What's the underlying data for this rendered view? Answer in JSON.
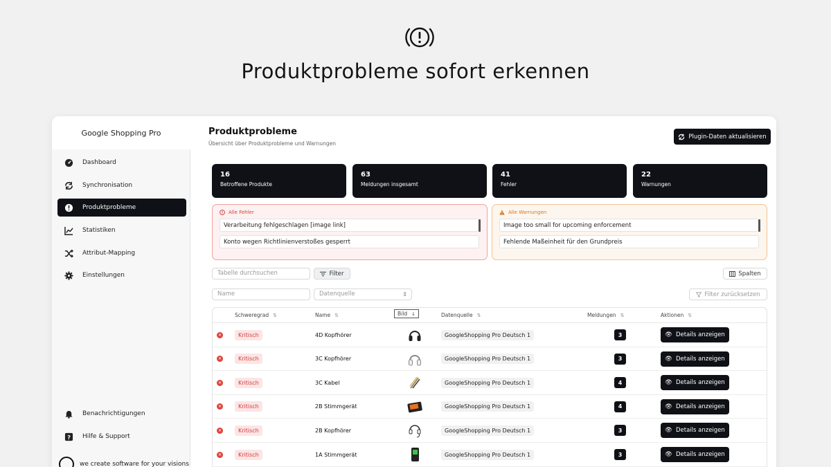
{
  "hero": {
    "icon": "alert-circle-icon",
    "title": "Produktprobleme sofort erkennen"
  },
  "sidebar": {
    "brand": "Google Shopping Pro",
    "items": [
      {
        "label": "Dashboard",
        "icon": "gauge-icon"
      },
      {
        "label": "Synchronisation",
        "icon": "sync-icon"
      },
      {
        "label": "Produktprobleme",
        "icon": "alert-icon",
        "active": true
      },
      {
        "label": "Statistiken",
        "icon": "chart-line-icon"
      },
      {
        "label": "Attribut-Mapping",
        "icon": "shuffle-icon"
      },
      {
        "label": "Einstellungen",
        "icon": "gear-icon"
      }
    ],
    "bottom_items": [
      {
        "label": "Benachrichtigungen",
        "icon": "bell-icon"
      },
      {
        "label": "Hilfe & Support",
        "icon": "help-icon"
      }
    ],
    "footer": "we create software for your visions"
  },
  "header": {
    "title": "Produktprobleme",
    "subtitle": "Übersicht über Produktprobleme und Warnungen",
    "refresh_label": "Plugin-Daten aktualisieren"
  },
  "stats": [
    {
      "value": "16",
      "label": "Betroffene Produkte"
    },
    {
      "value": "63",
      "label": "Meldungen insgesamt"
    },
    {
      "value": "41",
      "label": "Fehler"
    },
    {
      "value": "22",
      "label": "Warnungen"
    }
  ],
  "errors": {
    "heading": "Alle Fehler",
    "items": [
      "Verarbeitung fehlgeschlagen [image link]",
      "Konto wegen Richtlinienverstoßes gesperrt"
    ]
  },
  "warnings": {
    "heading": "Alle Warnungen",
    "items": [
      "Image too small for upcoming enforcement",
      "Fehlende Maßeinheit für den Grundpreis"
    ]
  },
  "toolbar": {
    "search_placeholder": "Tabelle durchsuchen",
    "filter_label": "Filter",
    "columns_label": "Spalten",
    "name_placeholder": "Name",
    "source_placeholder": "Datenquelle",
    "reset_label": "Filter zurücksetzen"
  },
  "table": {
    "columns": [
      "Schweregrad",
      "Name",
      "Bild",
      "Datenquelle",
      "Meldungen",
      "Aktionen"
    ],
    "details_label": "Details anzeigen",
    "rows": [
      {
        "severity": "Kritisch",
        "name": "4D Kopfhörer",
        "image": "headphones-black-icon",
        "source": "GoogleShopping Pro Deutsch 1",
        "count": "3"
      },
      {
        "severity": "Kritisch",
        "name": "3C Kopfhörer",
        "image": "headphones-white-icon",
        "source": "GoogleShopping Pro Deutsch 1",
        "count": "3"
      },
      {
        "severity": "Kritisch",
        "name": "3C Kabel",
        "image": "cable-icon",
        "source": "GoogleShopping Pro Deutsch 1",
        "count": "4"
      },
      {
        "severity": "Kritisch",
        "name": "2B Stimmgerät",
        "image": "tuner-orange-icon",
        "source": "GoogleShopping Pro Deutsch 1",
        "count": "4"
      },
      {
        "severity": "Kritisch",
        "name": "2B Kopfhörer",
        "image": "headphones-wired-icon",
        "source": "GoogleShopping Pro Deutsch 1",
        "count": "3"
      },
      {
        "severity": "Kritisch",
        "name": "1A Stimmgerät",
        "image": "tuner-green-icon",
        "source": "GoogleShopping Pro Deutsch 1",
        "count": "3"
      }
    ]
  }
}
